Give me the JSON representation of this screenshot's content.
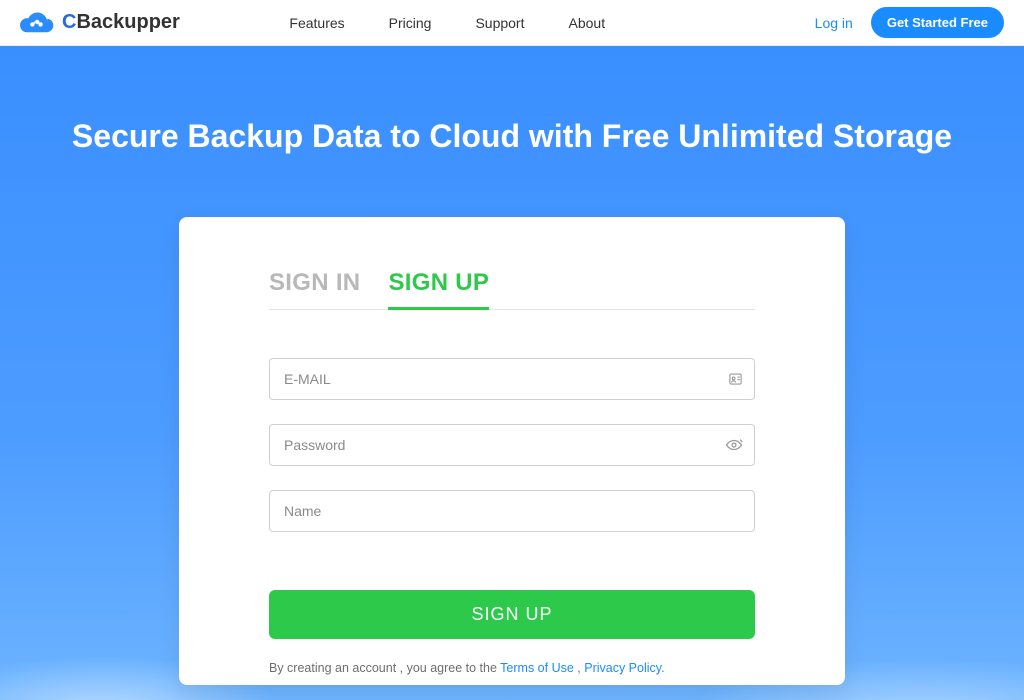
{
  "header": {
    "brand_name": "CBackupper",
    "nav": [
      "Features",
      "Pricing",
      "Support",
      "About"
    ],
    "login_label": "Log in",
    "cta_label": "Get Started Free"
  },
  "hero": {
    "title": "Secure Backup Data to Cloud with Free Unlimited Storage"
  },
  "form": {
    "tabs": {
      "signin": "SIGN IN",
      "signup": "SIGN UP"
    },
    "active_tab": "signup",
    "fields": {
      "email_placeholder": "E-MAIL",
      "password_placeholder": "Password",
      "name_placeholder": "Name"
    },
    "submit_label": "SIGN UP",
    "consent": {
      "prefix": "By creating an account , you agree to the ",
      "terms": "Terms of Use",
      "sep": " , ",
      "privacy": "Privacy Policy",
      "suffix": "."
    }
  },
  "colors": {
    "accent_blue": "#1a8cff",
    "accent_green": "#2dc94a"
  }
}
